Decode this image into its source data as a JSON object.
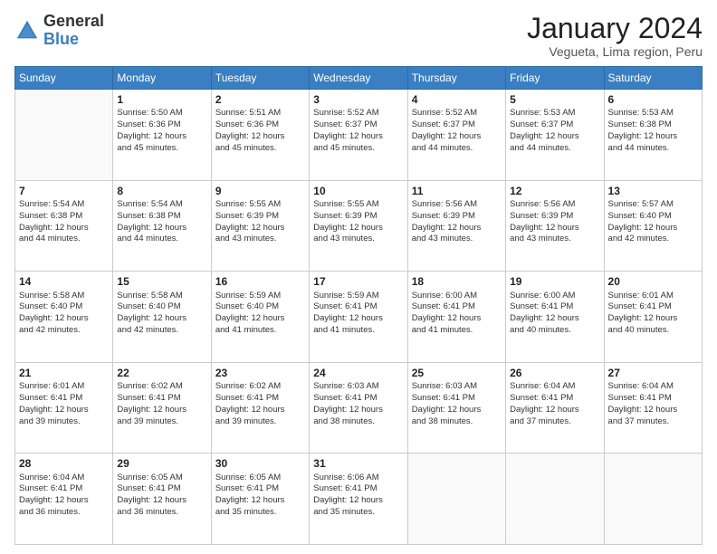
{
  "logo": {
    "general": "General",
    "blue": "Blue"
  },
  "header": {
    "title": "January 2024",
    "subtitle": "Vegueta, Lima region, Peru"
  },
  "weekdays": [
    "Sunday",
    "Monday",
    "Tuesday",
    "Wednesday",
    "Thursday",
    "Friday",
    "Saturday"
  ],
  "weeks": [
    [
      {
        "day": "",
        "info": ""
      },
      {
        "day": "1",
        "info": "Sunrise: 5:50 AM\nSunset: 6:36 PM\nDaylight: 12 hours\nand 45 minutes."
      },
      {
        "day": "2",
        "info": "Sunrise: 5:51 AM\nSunset: 6:36 PM\nDaylight: 12 hours\nand 45 minutes."
      },
      {
        "day": "3",
        "info": "Sunrise: 5:52 AM\nSunset: 6:37 PM\nDaylight: 12 hours\nand 45 minutes."
      },
      {
        "day": "4",
        "info": "Sunrise: 5:52 AM\nSunset: 6:37 PM\nDaylight: 12 hours\nand 44 minutes."
      },
      {
        "day": "5",
        "info": "Sunrise: 5:53 AM\nSunset: 6:37 PM\nDaylight: 12 hours\nand 44 minutes."
      },
      {
        "day": "6",
        "info": "Sunrise: 5:53 AM\nSunset: 6:38 PM\nDaylight: 12 hours\nand 44 minutes."
      }
    ],
    [
      {
        "day": "7",
        "info": "Sunrise: 5:54 AM\nSunset: 6:38 PM\nDaylight: 12 hours\nand 44 minutes."
      },
      {
        "day": "8",
        "info": "Sunrise: 5:54 AM\nSunset: 6:38 PM\nDaylight: 12 hours\nand 44 minutes."
      },
      {
        "day": "9",
        "info": "Sunrise: 5:55 AM\nSunset: 6:39 PM\nDaylight: 12 hours\nand 43 minutes."
      },
      {
        "day": "10",
        "info": "Sunrise: 5:55 AM\nSunset: 6:39 PM\nDaylight: 12 hours\nand 43 minutes."
      },
      {
        "day": "11",
        "info": "Sunrise: 5:56 AM\nSunset: 6:39 PM\nDaylight: 12 hours\nand 43 minutes."
      },
      {
        "day": "12",
        "info": "Sunrise: 5:56 AM\nSunset: 6:39 PM\nDaylight: 12 hours\nand 43 minutes."
      },
      {
        "day": "13",
        "info": "Sunrise: 5:57 AM\nSunset: 6:40 PM\nDaylight: 12 hours\nand 42 minutes."
      }
    ],
    [
      {
        "day": "14",
        "info": "Sunrise: 5:58 AM\nSunset: 6:40 PM\nDaylight: 12 hours\nand 42 minutes."
      },
      {
        "day": "15",
        "info": "Sunrise: 5:58 AM\nSunset: 6:40 PM\nDaylight: 12 hours\nand 42 minutes."
      },
      {
        "day": "16",
        "info": "Sunrise: 5:59 AM\nSunset: 6:40 PM\nDaylight: 12 hours\nand 41 minutes."
      },
      {
        "day": "17",
        "info": "Sunrise: 5:59 AM\nSunset: 6:41 PM\nDaylight: 12 hours\nand 41 minutes."
      },
      {
        "day": "18",
        "info": "Sunrise: 6:00 AM\nSunset: 6:41 PM\nDaylight: 12 hours\nand 41 minutes."
      },
      {
        "day": "19",
        "info": "Sunrise: 6:00 AM\nSunset: 6:41 PM\nDaylight: 12 hours\nand 40 minutes."
      },
      {
        "day": "20",
        "info": "Sunrise: 6:01 AM\nSunset: 6:41 PM\nDaylight: 12 hours\nand 40 minutes."
      }
    ],
    [
      {
        "day": "21",
        "info": "Sunrise: 6:01 AM\nSunset: 6:41 PM\nDaylight: 12 hours\nand 39 minutes."
      },
      {
        "day": "22",
        "info": "Sunrise: 6:02 AM\nSunset: 6:41 PM\nDaylight: 12 hours\nand 39 minutes."
      },
      {
        "day": "23",
        "info": "Sunrise: 6:02 AM\nSunset: 6:41 PM\nDaylight: 12 hours\nand 39 minutes."
      },
      {
        "day": "24",
        "info": "Sunrise: 6:03 AM\nSunset: 6:41 PM\nDaylight: 12 hours\nand 38 minutes."
      },
      {
        "day": "25",
        "info": "Sunrise: 6:03 AM\nSunset: 6:41 PM\nDaylight: 12 hours\nand 38 minutes."
      },
      {
        "day": "26",
        "info": "Sunrise: 6:04 AM\nSunset: 6:41 PM\nDaylight: 12 hours\nand 37 minutes."
      },
      {
        "day": "27",
        "info": "Sunrise: 6:04 AM\nSunset: 6:41 PM\nDaylight: 12 hours\nand 37 minutes."
      }
    ],
    [
      {
        "day": "28",
        "info": "Sunrise: 6:04 AM\nSunset: 6:41 PM\nDaylight: 12 hours\nand 36 minutes."
      },
      {
        "day": "29",
        "info": "Sunrise: 6:05 AM\nSunset: 6:41 PM\nDaylight: 12 hours\nand 36 minutes."
      },
      {
        "day": "30",
        "info": "Sunrise: 6:05 AM\nSunset: 6:41 PM\nDaylight: 12 hours\nand 35 minutes."
      },
      {
        "day": "31",
        "info": "Sunrise: 6:06 AM\nSunset: 6:41 PM\nDaylight: 12 hours\nand 35 minutes."
      },
      {
        "day": "",
        "info": ""
      },
      {
        "day": "",
        "info": ""
      },
      {
        "day": "",
        "info": ""
      }
    ]
  ]
}
